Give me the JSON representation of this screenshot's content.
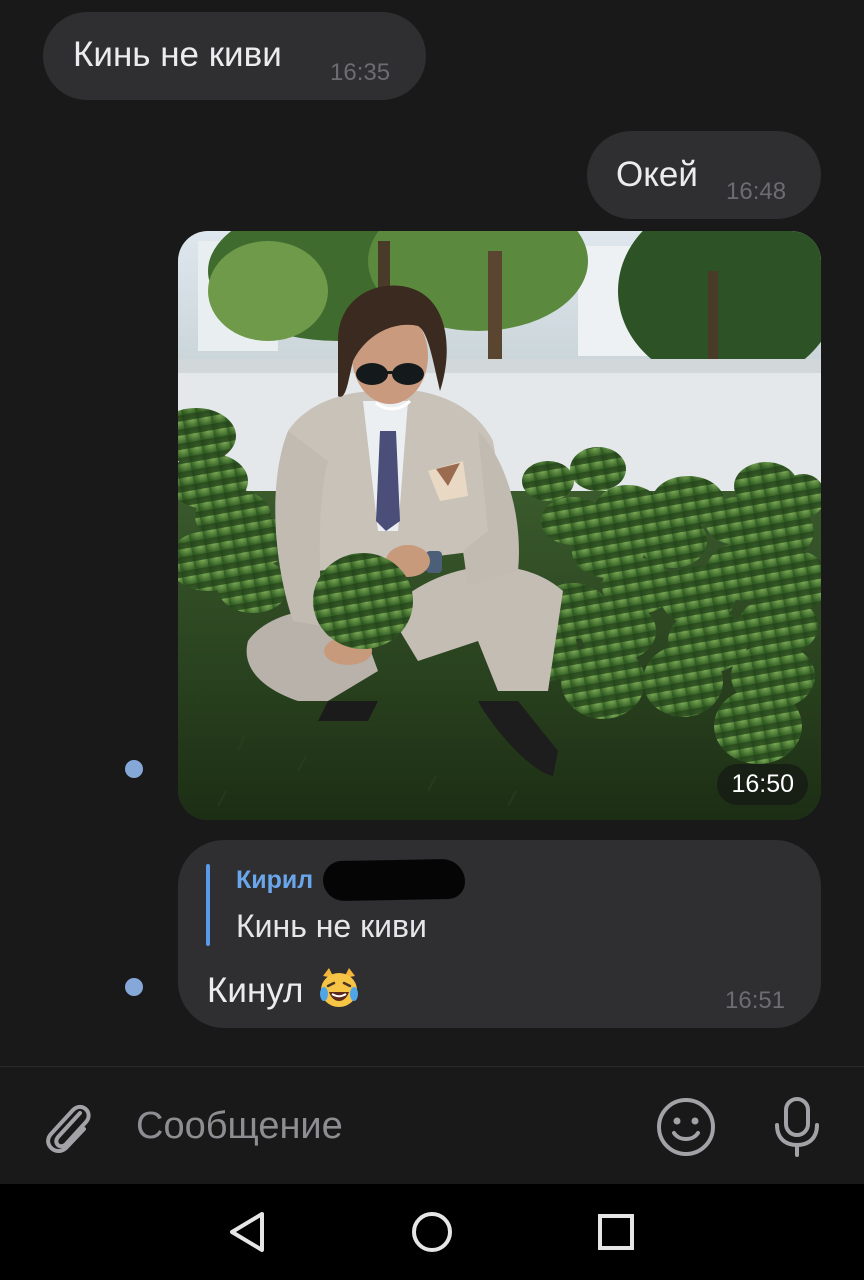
{
  "messages": [
    {
      "id": "incoming-1",
      "direction": "incoming",
      "text": "Кинь не киви",
      "time": "16:35"
    },
    {
      "id": "outgoing-ok",
      "direction": "outgoing",
      "text": "Окей",
      "time": "16:48"
    },
    {
      "id": "outgoing-photo",
      "direction": "outgoing",
      "type": "photo",
      "time": "16:50"
    },
    {
      "id": "outgoing-reply",
      "direction": "outgoing",
      "reply_to": {
        "author": "Кирил",
        "text": "Кинь не киви"
      },
      "text": "Кинул",
      "emoji": "cat-with-tears-of-joy",
      "time": "16:51"
    }
  ],
  "composer": {
    "placeholder": "Сообщение",
    "attach_icon": "paperclip-icon",
    "emoji_icon": "smiley-icon",
    "mic_icon": "microphone-icon"
  },
  "navbar": {
    "icons": [
      "back-triangle-icon",
      "home-circle-icon",
      "recents-square-icon"
    ]
  },
  "colors": {
    "background": "#19191a",
    "bubble": "#2f2f32",
    "accent": "#5a9ae8",
    "unread_dot": "#86a8d8",
    "time": "#6c6c71"
  }
}
